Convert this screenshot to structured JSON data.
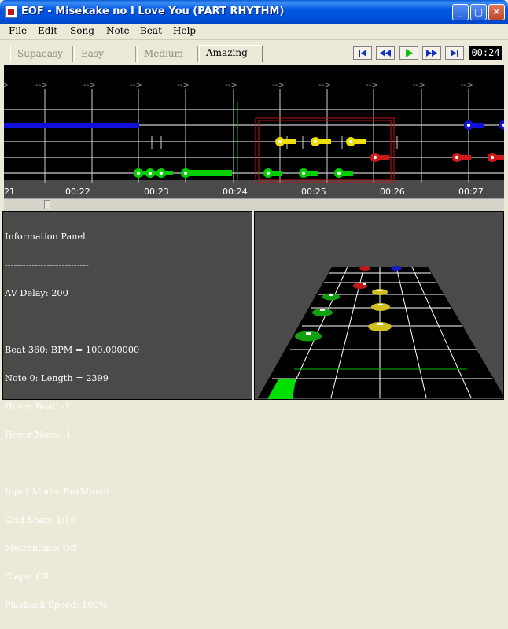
{
  "window": {
    "title": "EOF - Misekake no I Love You (PART RHYTHM)"
  },
  "menu": [
    {
      "first": "F",
      "rest": "ile"
    },
    {
      "first": "E",
      "rest": "dit"
    },
    {
      "first": "S",
      "rest": "ong"
    },
    {
      "first": "N",
      "rest": "ote"
    },
    {
      "first": "B",
      "rest": "eat"
    },
    {
      "first": "H",
      "rest": "elp"
    }
  ],
  "difficulty_tabs": [
    {
      "label": "Supaeasy",
      "active": false
    },
    {
      "label": "Easy",
      "active": false
    },
    {
      "label": "Medium",
      "active": false
    },
    {
      "label": "Amazing",
      "active": true
    }
  ],
  "playback": {
    "buttons": [
      "rewind-to-start",
      "rewind",
      "play",
      "fast-forward",
      "forward-to-end"
    ],
    "time": "00:24"
  },
  "timeline": {
    "labels": [
      "21",
      "00:22",
      "00:23",
      "00:24",
      "00:25",
      "00:26",
      "00:27"
    ],
    "beat_arrow": "-->"
  },
  "info_panel": {
    "title": "Information Panel",
    "divider": "----------------------------",
    "av_delay": "AV Delay: 200",
    "beat": "Beat 360: BPM = 100.000000",
    "note": "Note 0: Length = 2399",
    "hover_beat": "Hover Beat: -1",
    "hover_note": "Hover Note: -1",
    "input_mode": "Input Mode: RexMundi",
    "grid_snap": "Grid Snap: 1/16",
    "metronome": "Metronome: Off",
    "claps": "Claps: Off",
    "playback_speed": "Playback Speed: 100%"
  },
  "colors": {
    "green": "#00D000",
    "red": "#D01818",
    "yellow": "#F0E000",
    "blue": "#1010D8",
    "selection": "#C01818"
  }
}
